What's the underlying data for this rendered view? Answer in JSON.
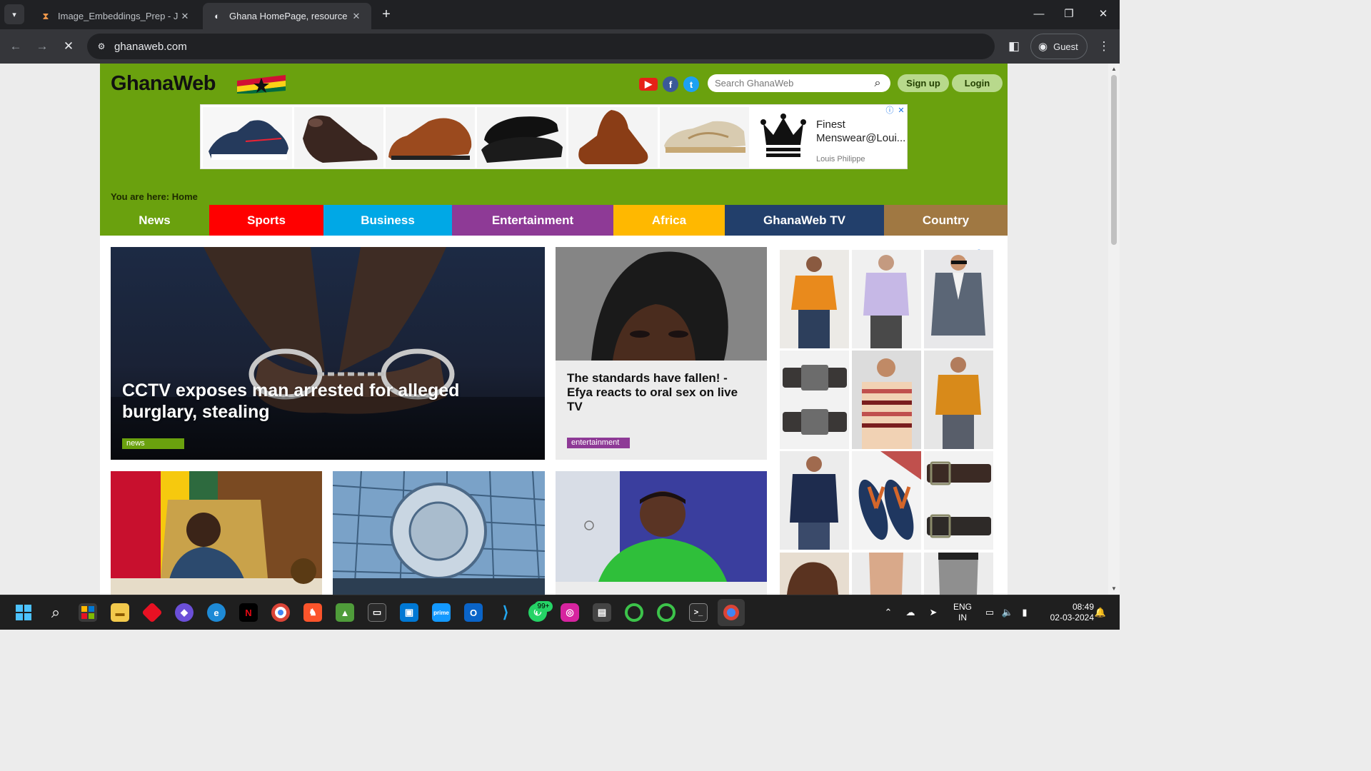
{
  "browser": {
    "tabs": [
      {
        "title": "Image_Embeddings_Prep - Jupy",
        "icon": "hourglass-icon",
        "active": false
      },
      {
        "title": "Ghana HomePage, resource for",
        "icon": "globe-icon",
        "active": true
      }
    ],
    "url": "ghanaweb.com",
    "profile": "Guest"
  },
  "site": {
    "logo": "GhanaWeb",
    "search_placeholder": "Search GhanaWeb",
    "signup_label": "Sign up",
    "login_label": "Login",
    "breadcrumb_prefix": "You are here:",
    "breadcrumb_current": "Home",
    "nav": [
      {
        "label": "News",
        "color": "#6aa10e"
      },
      {
        "label": "Sports",
        "color": "#ff0000"
      },
      {
        "label": "Business",
        "color": "#00a8e6"
      },
      {
        "label": "Entertainment",
        "color": "#8e3a96"
      },
      {
        "label": "Africa",
        "color": "#ffb800"
      },
      {
        "label": "GhanaWeb TV",
        "color": "#223f6b"
      },
      {
        "label": "Country",
        "color": "#a07842"
      }
    ],
    "top_ad": {
      "text_line1": "Finest",
      "text_line2": "Menswear@Loui...",
      "brand": "Louis Philippe"
    },
    "stories": {
      "hero": {
        "title": "CCTV exposes man arrested for alleged burglary, stealing",
        "tag": "news",
        "tag_color": "#6aa10e"
      },
      "second": {
        "title": "The standards have fallen! - Efya reacts to oral sex on live TV",
        "tag": "entertainment",
        "tag_color": "#8e3a96"
      }
    }
  },
  "taskbar": {
    "language": "ENG",
    "region": "IN",
    "time": "08:49",
    "date": "02-03-2024",
    "whatsapp_badge": "99+"
  },
  "colors": {
    "header_green": "#6aa10e",
    "chrome_dark": "#202124",
    "chrome_mid": "#35363a"
  }
}
